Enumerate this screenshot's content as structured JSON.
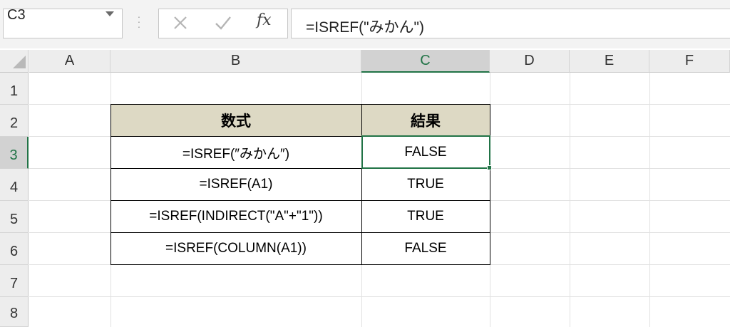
{
  "name_box": {
    "value": "C3"
  },
  "formula_bar": {
    "fx_label": "fx",
    "formula": "=ISREF(\"みかん\")"
  },
  "columns": [
    "A",
    "B",
    "C",
    "D",
    "E",
    "F"
  ],
  "rows": [
    "1",
    "2",
    "3",
    "4",
    "5",
    "6",
    "7",
    "8"
  ],
  "selected_cell": "C3",
  "table": {
    "headers": [
      "数式",
      "結果"
    ],
    "rows": [
      {
        "formula": "=ISREF(″みかん″)",
        "result": "FALSE"
      },
      {
        "formula": "=ISREF(A1)",
        "result": "TRUE"
      },
      {
        "formula": "=ISREF(INDIRECT(\"A\"+\"1\"))",
        "result": "TRUE"
      },
      {
        "formula": "=ISREF(COLUMN(A1))",
        "result": "FALSE"
      }
    ]
  },
  "colors": {
    "accent": "#217346",
    "table_header_fill": "#ddd9c4"
  }
}
